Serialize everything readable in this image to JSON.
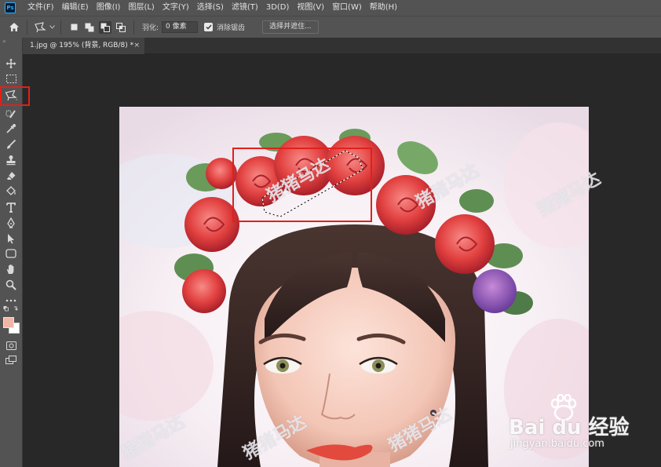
{
  "app": {
    "logo_text": "Ps"
  },
  "menubar": {
    "items": [
      "文件(F)",
      "编辑(E)",
      "图像(I)",
      "图层(L)",
      "文字(Y)",
      "选择(S)",
      "滤镜(T)",
      "3D(D)",
      "视图(V)",
      "窗口(W)",
      "帮助(H)"
    ]
  },
  "options": {
    "feather_label": "羽化:",
    "feather_value": "0 像素",
    "antialias_label": "消除锯齿",
    "antialias_checked": true,
    "select_mask_button": "选择并遮住..."
  },
  "document": {
    "tab_title": "1.jpg @ 195% (背景, RGB/8) *",
    "close_glyph": "×"
  },
  "tools": {
    "active": "polygonal-lasso-tool",
    "foreground_color": "#f0b6a8",
    "background_color": "#ffffff"
  },
  "watermark": {
    "text": "猪猪马达",
    "baidu_logo": "Bai du 经验",
    "baidu_url": "jingyan.baidu.com"
  },
  "colors": {
    "annotation": "#e0201b",
    "chrome": "#535353",
    "workspace": "#282828"
  }
}
